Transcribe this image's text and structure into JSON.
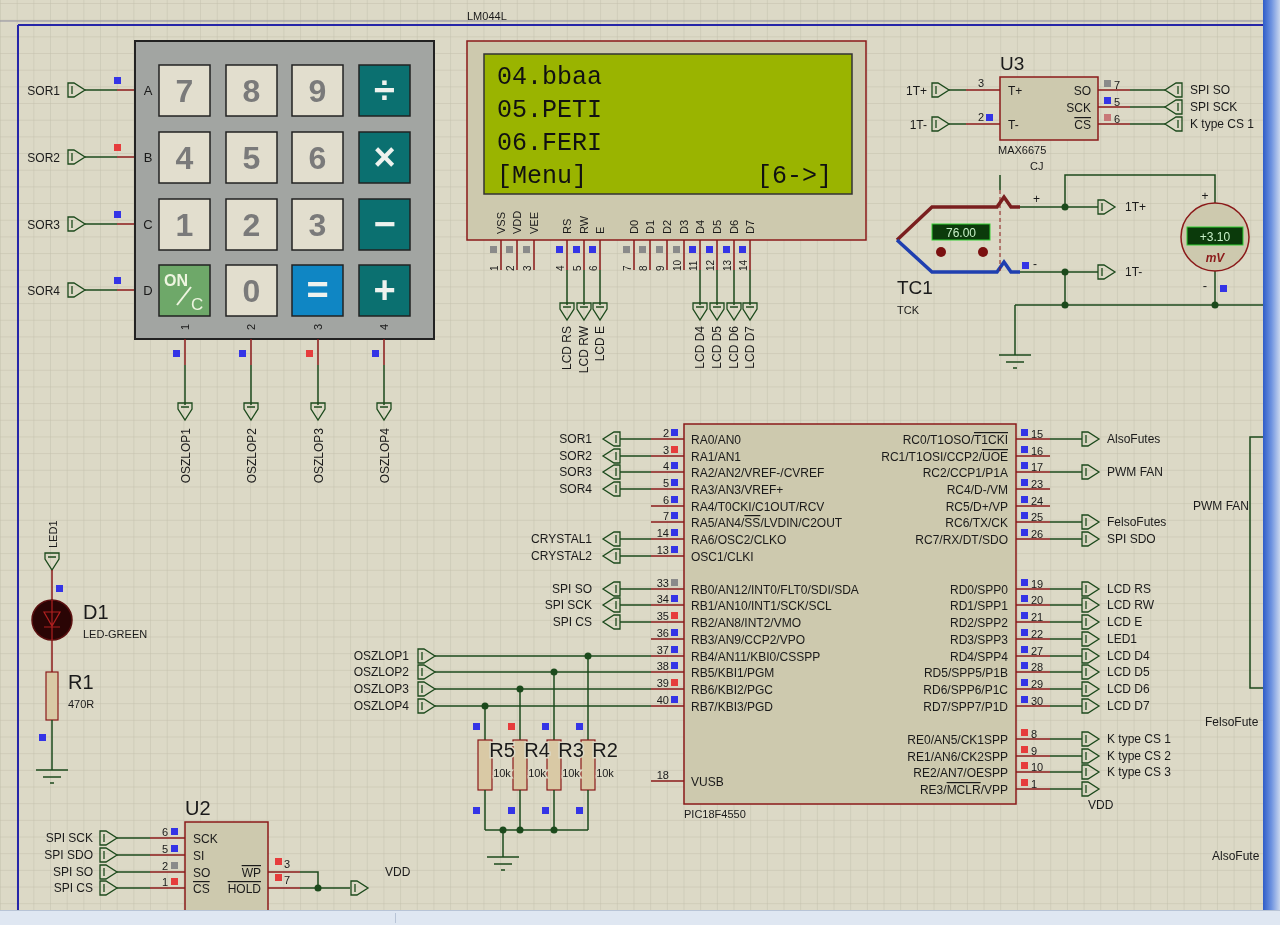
{
  "keypad": {
    "rows": [
      {
        "label": "A",
        "net": "SOR1",
        "color": "#3434e6"
      },
      {
        "label": "B",
        "net": "SOR2",
        "color": "#e63c3c"
      },
      {
        "label": "C",
        "net": "SOR3",
        "color": "#3434e6"
      },
      {
        "label": "D",
        "net": "SOR4",
        "color": "#3434e6"
      }
    ],
    "keys": [
      [
        {
          "kind": "digit",
          "label": "7"
        },
        {
          "kind": "digit",
          "label": "8"
        },
        {
          "kind": "digit",
          "label": "9"
        },
        {
          "kind": "operator",
          "label": "÷"
        }
      ],
      [
        {
          "kind": "digit",
          "label": "4"
        },
        {
          "kind": "digit",
          "label": "5"
        },
        {
          "kind": "digit",
          "label": "6"
        },
        {
          "kind": "operator",
          "label": "×"
        }
      ],
      [
        {
          "kind": "digit",
          "label": "1"
        },
        {
          "kind": "digit",
          "label": "2"
        },
        {
          "kind": "digit",
          "label": "3"
        },
        {
          "kind": "operator",
          "label": "−"
        }
      ],
      [
        {
          "kind": "clear",
          "label": "ON",
          "sub": "C"
        },
        {
          "kind": "digit",
          "label": "0"
        },
        {
          "kind": "equals",
          "label": "="
        },
        {
          "kind": "operator",
          "label": "+"
        }
      ]
    ],
    "columns": [
      {
        "label": "1",
        "net": "OSZLOP1",
        "color": "#3434e6"
      },
      {
        "label": "2",
        "net": "OSZLOP2",
        "color": "#3434e6"
      },
      {
        "label": "3",
        "net": "OSZLOP3",
        "color": "#e63c3c"
      },
      {
        "label": "4",
        "net": "OSZLOP4",
        "color": "#3434e6"
      }
    ]
  },
  "lcd": {
    "model": "LM044L",
    "lines": [
      "04.bbaa",
      "05.PETI",
      "06.FERI"
    ],
    "status_left": "[Menu]",
    "status_right": "[6->]",
    "pins": [
      {
        "name": "VSS",
        "number": "1",
        "color": "#8a8a8a"
      },
      {
        "name": "VDD",
        "number": "2",
        "color": "#8a8a8a"
      },
      {
        "name": "VEE",
        "number": "3",
        "color": "#8a8a8a"
      },
      {
        "name": "RS",
        "number": "4",
        "color": "#3434e6",
        "net": "LCD RS"
      },
      {
        "name": "RW",
        "number": "5",
        "color": "#3434e6",
        "net": "LCD RW"
      },
      {
        "name": "E",
        "number": "6",
        "color": "#3434e6",
        "net": "LCD E"
      },
      {
        "name": "D0",
        "number": "7",
        "color": "#8a8a8a"
      },
      {
        "name": "D1",
        "number": "8",
        "color": "#8a8a8a"
      },
      {
        "name": "D2",
        "number": "9",
        "color": "#8a8a8a"
      },
      {
        "name": "D3",
        "number": "10",
        "color": "#8a8a8a"
      },
      {
        "name": "D4",
        "number": "11",
        "color": "#3434e6",
        "net": "LCD D4"
      },
      {
        "name": "D5",
        "number": "12",
        "color": "#3434e6",
        "net": "LCD D5"
      },
      {
        "name": "D6",
        "number": "13",
        "color": "#3434e6",
        "net": "LCD D6"
      },
      {
        "name": "D7",
        "number": "14",
        "color": "#3434e6",
        "net": "LCD D7"
      }
    ]
  },
  "u3": {
    "reference": "U3",
    "part": "MAX6675",
    "note": "CJ",
    "left_pins": [
      {
        "number": "3",
        "name": "T+",
        "net": "1T+"
      },
      {
        "number": "2",
        "name": "T-",
        "color": "#3434e6",
        "net": "1T-"
      }
    ],
    "right_pins": [
      {
        "number": "7",
        "name": "SO",
        "color": "#8a8a8a",
        "net": "SPI SO"
      },
      {
        "number": "5",
        "name": "SCK",
        "color": "#3434e6",
        "net": "SPI SCK"
      },
      {
        "number": "6",
        "name": "CS",
        "overline": true,
        "color": "#c87878",
        "net": "K type CS 1"
      }
    ]
  },
  "thermocouple": {
    "reference": "TC1",
    "type": "TCK",
    "reading": "76.00",
    "plus": "+",
    "minus": "-",
    "minus_marker": {
      "color": "#3434e6"
    },
    "plus_net": "1T+",
    "minus_net": "1T-"
  },
  "voltmeter": {
    "reading": "+3.10",
    "unit": "mV",
    "plus": "+",
    "minus": "-",
    "marker": {
      "color": "#3434e6"
    }
  },
  "pic": {
    "part": "PIC18F4550",
    "left_pins": [
      {
        "number": "2",
        "name": "RA0/AN0",
        "color": "#3434e6",
        "net": "SOR1"
      },
      {
        "number": "3",
        "name": "RA1/AN1",
        "color": "#e63c3c",
        "net": "SOR2"
      },
      {
        "number": "4",
        "name": "RA2/AN2/VREF-/CVREF",
        "color": "#3434e6",
        "net": "SOR3"
      },
      {
        "number": "5",
        "name": "RA3/AN3/VREF+",
        "color": "#3434e6",
        "net": "SOR4"
      },
      {
        "number": "6",
        "name": "RA4/T0CKI/C1OUT/RCV",
        "color": "#3434e6"
      },
      {
        "number": "7",
        "name": [
          "RA5/AN4/",
          "SS",
          "/LVDIN/C2OUT"
        ],
        "color": "#3434e6"
      },
      {
        "number": "14",
        "name": "RA6/OSC2/CLKO",
        "color": "#3434e6",
        "net": "CRYSTAL1"
      },
      {
        "number": "13",
        "name": "OSC1/CLKI",
        "color": "#3434e6",
        "net": "CRYSTAL2"
      },
      {
        "number": "33",
        "name": "RB0/AN12/INT0/FLT0/SDI/SDA",
        "color": "#8a8a8a",
        "net": "SPI SO"
      },
      {
        "number": "34",
        "name": "RB1/AN10/INT1/SCK/SCL",
        "color": "#3434e6",
        "net": "SPI SCK"
      },
      {
        "number": "35",
        "name": "RB2/AN8/INT2/VMO",
        "color": "#e63c3c",
        "net": "SPI CS"
      },
      {
        "number": "36",
        "name": "RB3/AN9/CCP2/VPO",
        "color": "#3434e6"
      },
      {
        "number": "37",
        "name": "RB4/AN11/KBI0/CSSPP",
        "color": "#3434e6",
        "net": "OSZLOP1"
      },
      {
        "number": "38",
        "name": "RB5/KBI1/PGM",
        "color": "#3434e6",
        "net": "OSZLOP2"
      },
      {
        "number": "39",
        "name": "RB6/KBI2/PGC",
        "color": "#e63c3c",
        "net": "OSZLOP3"
      },
      {
        "number": "40",
        "name": "RB7/KBI3/PGD",
        "color": "#3434e6",
        "net": "OSZLOP4"
      },
      {
        "number": "18",
        "name": "VUSB"
      }
    ],
    "right_pins": [
      {
        "number": "15",
        "name": [
          "RC0/T1OSO/",
          "T1CKI"
        ],
        "color": "#3434e6",
        "net": "AlsoFutes"
      },
      {
        "number": "16",
        "name": [
          "RC1/T1OSI/CCP2/",
          "UOE"
        ],
        "color": "#3434e6"
      },
      {
        "number": "17",
        "name": "RC2/CCP1/P1A",
        "color": "#3434e6",
        "net": "PWM FAN"
      },
      {
        "number": "23",
        "name": "RC4/D-/VM",
        "color": "#3434e6"
      },
      {
        "number": "24",
        "name": "RC5/D+/VP",
        "color": "#3434e6"
      },
      {
        "number": "25",
        "name": "RC6/TX/CK",
        "color": "#3434e6",
        "net": "FelsoFutes"
      },
      {
        "number": "26",
        "name": "RC7/RX/DT/SDO",
        "color": "#3434e6",
        "net": "SPI SDO"
      },
      {
        "number": "19",
        "name": "RD0/SPP0",
        "color": "#3434e6",
        "net": "LCD RS"
      },
      {
        "number": "20",
        "name": "RD1/SPP1",
        "color": "#3434e6",
        "net": "LCD RW"
      },
      {
        "number": "21",
        "name": "RD2/SPP2",
        "color": "#3434e6",
        "net": "LCD E"
      },
      {
        "number": "22",
        "name": "RD3/SPP3",
        "color": "#3434e6",
        "net": "LED1"
      },
      {
        "number": "27",
        "name": "RD4/SPP4",
        "color": "#3434e6",
        "net": "LCD D4"
      },
      {
        "number": "28",
        "name": "RD5/SPP5/P1B",
        "color": "#3434e6",
        "net": "LCD D5"
      },
      {
        "number": "29",
        "name": "RD6/SPP6/P1C",
        "color": "#3434e6",
        "net": "LCD D6"
      },
      {
        "number": "30",
        "name": "RD7/SPP7/P1D",
        "color": "#3434e6",
        "net": "LCD D7"
      },
      {
        "number": "8",
        "name": "RE0/AN5/CK1SPP",
        "color": "#e63c3c",
        "net": "K type CS 1"
      },
      {
        "number": "9",
        "name": "RE1/AN6/CK2SPP",
        "color": "#e63c3c",
        "net": "K type CS 2"
      },
      {
        "number": "10",
        "name": "RE2/AN7/OESPP",
        "color": "#e63c3c",
        "net": "K type CS 3"
      },
      {
        "number": "1",
        "name": [
          "RE3/",
          "MCLR",
          "/VPP"
        ],
        "color": "#e63c3c",
        "net": "VDD"
      }
    ]
  },
  "resistors": [
    {
      "reference": "R5",
      "value": "10k",
      "markers": [
        {
          "color": "#3434e6"
        },
        {
          "color": "#3434e6"
        }
      ]
    },
    {
      "reference": "R4",
      "value": "10k",
      "markers": [
        {
          "color": "#e63c3c"
        },
        {
          "color": "#3434e6"
        }
      ]
    },
    {
      "reference": "R3",
      "value": "10k",
      "markers": [
        {
          "color": "#3434e6"
        },
        {
          "color": "#3434e6"
        }
      ]
    },
    {
      "reference": "R2",
      "value": "10k",
      "markers": [
        {
          "color": "#3434e6"
        },
        {
          "color": "#3434e6"
        }
      ]
    }
  ],
  "led": {
    "net": "LED1",
    "reference": "D1",
    "part": "LED-GREEN",
    "marker": {
      "color": "#3434e6"
    }
  },
  "r1": {
    "reference": "R1",
    "value": "470R",
    "marker": {
      "color": "#3434e6"
    }
  },
  "u2": {
    "reference": "U2",
    "net": "VDD",
    "left_pins": [
      {
        "number": "6",
        "name": "SCK",
        "color": "#3434e6",
        "net": "SPI SCK"
      },
      {
        "number": "5",
        "name": "SI",
        "color": "#3434e6",
        "net": "SPI SDO"
      },
      {
        "number": "2",
        "name": "SO",
        "color": "#8a8a8a",
        "net": "SPI SO"
      },
      {
        "number": "1",
        "name": "CS",
        "overline": true,
        "color": "#e63c3c",
        "net": "SPI CS"
      }
    ],
    "right_pins": [
      {
        "number": "3",
        "name": "WP",
        "overline": true,
        "color": "#e63c3c"
      },
      {
        "number": "7",
        "name": "HOLD",
        "overline": true,
        "color": "#e63c3c"
      }
    ]
  },
  "offsheet_labels": [
    "PWM FAN",
    "FelsoFute",
    "AlsoFute"
  ]
}
